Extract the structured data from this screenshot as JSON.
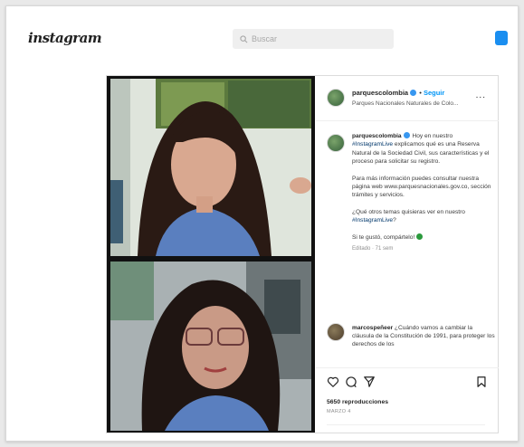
{
  "header": {
    "logo": "instagram",
    "search_placeholder": "Buscar"
  },
  "post": {
    "username": "parquescolombia",
    "separator": "•",
    "follow_label": "Seguir",
    "subtitle": "Parques Nacionales Naturales de Colo...",
    "more_label": "...",
    "caption": {
      "username": "parquescolombia",
      "p1_before": "Hoy en nuestro ",
      "p1_tag": "#InstagramLive",
      "p1_after": " explicamos qué es una Reserva Natural de la Sociedad Civil, sus características y el proceso para solicitar su registro.",
      "p2": "Para más información puedes consultar nuestra página web www.parquesnacionales.gov.co, sección trámites y servicios.",
      "p3_before": "¿Qué otros temas quisieras ver en nuestro ",
      "p3_tag": "#InstagramLive",
      "p3_after": "?",
      "p4": "Si te gustó, compártelo! ",
      "time": "Editado · 71 sem"
    },
    "comment": {
      "username": "marcospeñeer",
      "text": " ¿Cuándo vamos a cambiar la cláusula de la Constitución de 1991, para proteger los derechos de los"
    },
    "views": "5650 reproducciones",
    "date": "MARZO 4"
  },
  "colors": {
    "accent_blue": "#0095f6",
    "message_icon": "#1a8ef0",
    "green_dot": "#2b9a3d"
  },
  "icons": [
    "search-icon",
    "messenger-icon",
    "heart-icon",
    "comment-icon",
    "share-icon",
    "bookmark-icon"
  ]
}
